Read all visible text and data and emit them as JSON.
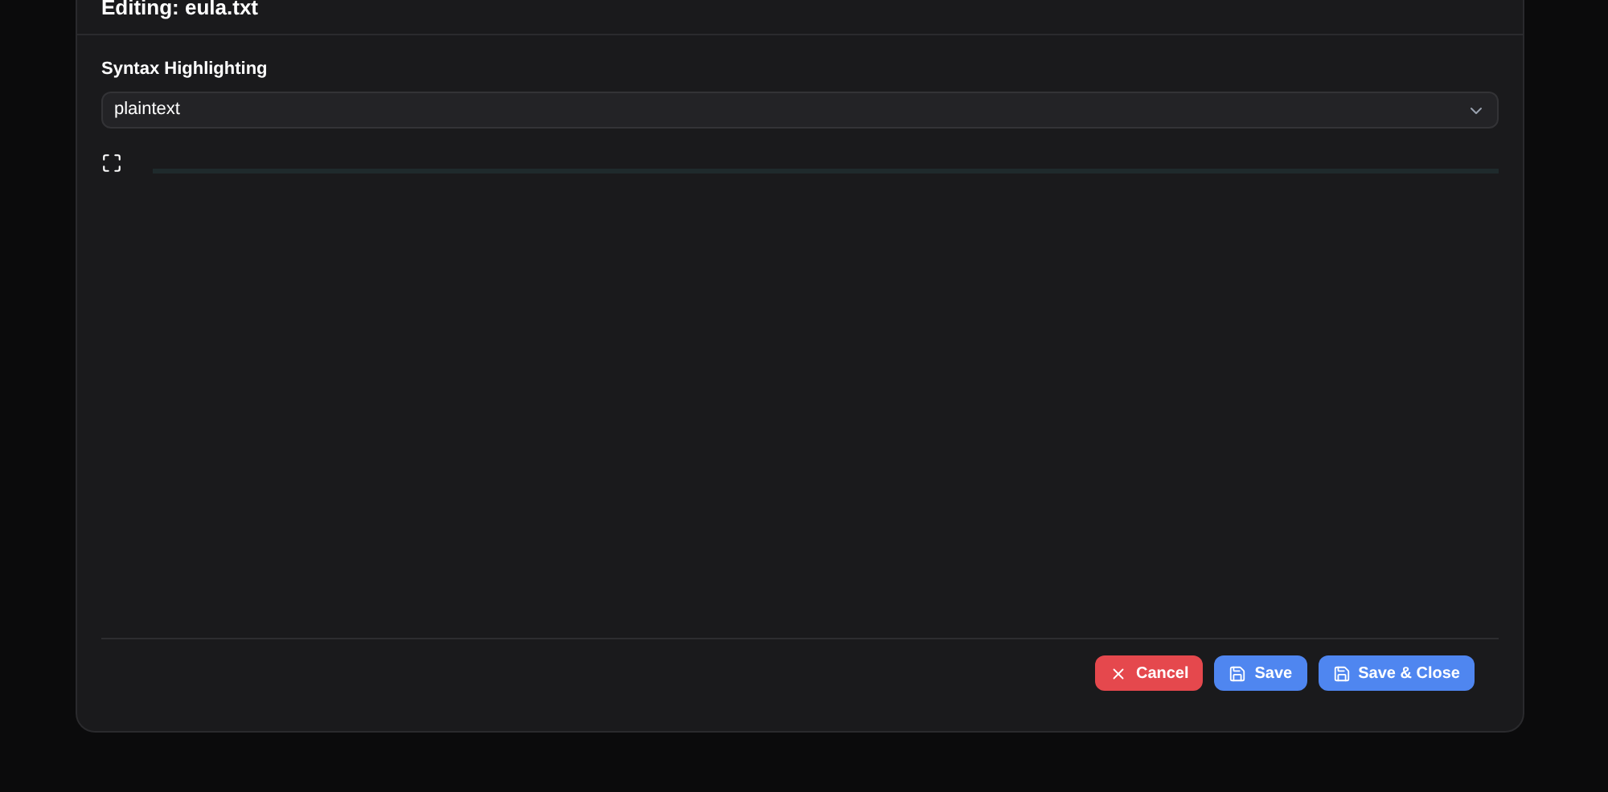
{
  "dialog": {
    "title": "Editing: eula.txt"
  },
  "syntax": {
    "label": "Syntax Highlighting",
    "value": "plaintext"
  },
  "buttons": [
    {
      "kind": "cancel",
      "label": "Cancel"
    },
    {
      "kind": "save",
      "label": "Save"
    },
    {
      "kind": "save",
      "label": "Save & Close"
    }
  ]
}
